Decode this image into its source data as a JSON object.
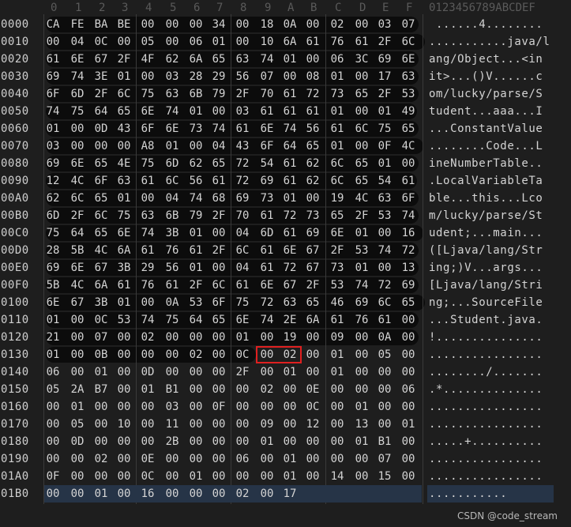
{
  "header": {
    "columns": [
      "0",
      "1",
      "2",
      "3",
      "4",
      "5",
      "6",
      "7",
      "8",
      "9",
      "A",
      "B",
      "C",
      "D",
      "E",
      "F"
    ],
    "ascii_header": "0123456789ABCDEF"
  },
  "rows": [
    {
      "offset": "0000",
      "bytes": [
        "CA",
        "FE",
        "BA",
        "BE",
        "00",
        "00",
        "00",
        "34",
        "00",
        "18",
        "0A",
        "00",
        "02",
        "00",
        "03",
        "07"
      ],
      "ascii": " ......4........"
    },
    {
      "offset": "0010",
      "bytes": [
        "00",
        "04",
        "0C",
        "00",
        "05",
        "00",
        "06",
        "01",
        "00",
        "10",
        "6A",
        "61",
        "76",
        "61",
        "2F",
        "6C"
      ],
      "ascii": "...........java/l"
    },
    {
      "offset": "0020",
      "bytes": [
        "61",
        "6E",
        "67",
        "2F",
        "4F",
        "62",
        "6A",
        "65",
        "63",
        "74",
        "01",
        "00",
        "06",
        "3C",
        "69",
        "6E"
      ],
      "ascii": "ang/Object...<in"
    },
    {
      "offset": "0030",
      "bytes": [
        "69",
        "74",
        "3E",
        "01",
        "00",
        "03",
        "28",
        "29",
        "56",
        "07",
        "00",
        "08",
        "01",
        "00",
        "17",
        "63"
      ],
      "ascii": "it>...()V......c"
    },
    {
      "offset": "0040",
      "bytes": [
        "6F",
        "6D",
        "2F",
        "6C",
        "75",
        "63",
        "6B",
        "79",
        "2F",
        "70",
        "61",
        "72",
        "73",
        "65",
        "2F",
        "53"
      ],
      "ascii": "om/lucky/parse/S"
    },
    {
      "offset": "0050",
      "bytes": [
        "74",
        "75",
        "64",
        "65",
        "6E",
        "74",
        "01",
        "00",
        "03",
        "61",
        "61",
        "61",
        "01",
        "00",
        "01",
        "49"
      ],
      "ascii": "tudent...aaa...I"
    },
    {
      "offset": "0060",
      "bytes": [
        "01",
        "00",
        "0D",
        "43",
        "6F",
        "6E",
        "73",
        "74",
        "61",
        "6E",
        "74",
        "56",
        "61",
        "6C",
        "75",
        "65"
      ],
      "ascii": "...ConstantValue"
    },
    {
      "offset": "0070",
      "bytes": [
        "03",
        "00",
        "00",
        "00",
        "A8",
        "01",
        "00",
        "04",
        "43",
        "6F",
        "64",
        "65",
        "01",
        "00",
        "0F",
        "4C"
      ],
      "ascii": "........Code...L"
    },
    {
      "offset": "0080",
      "bytes": [
        "69",
        "6E",
        "65",
        "4E",
        "75",
        "6D",
        "62",
        "65",
        "72",
        "54",
        "61",
        "62",
        "6C",
        "65",
        "01",
        "00"
      ],
      "ascii": "ineNumberTable.."
    },
    {
      "offset": "0090",
      "bytes": [
        "12",
        "4C",
        "6F",
        "63",
        "61",
        "6C",
        "56",
        "61",
        "72",
        "69",
        "61",
        "62",
        "6C",
        "65",
        "54",
        "61"
      ],
      "ascii": ".LocalVariableTa"
    },
    {
      "offset": "00A0",
      "bytes": [
        "62",
        "6C",
        "65",
        "01",
        "00",
        "04",
        "74",
        "68",
        "69",
        "73",
        "01",
        "00",
        "19",
        "4C",
        "63",
        "6F"
      ],
      "ascii": "ble...this...Lco"
    },
    {
      "offset": "00B0",
      "bytes": [
        "6D",
        "2F",
        "6C",
        "75",
        "63",
        "6B",
        "79",
        "2F",
        "70",
        "61",
        "72",
        "73",
        "65",
        "2F",
        "53",
        "74"
      ],
      "ascii": "m/lucky/parse/St"
    },
    {
      "offset": "00C0",
      "bytes": [
        "75",
        "64",
        "65",
        "6E",
        "74",
        "3B",
        "01",
        "00",
        "04",
        "6D",
        "61",
        "69",
        "6E",
        "01",
        "00",
        "16"
      ],
      "ascii": "udent;...main..."
    },
    {
      "offset": "00D0",
      "bytes": [
        "28",
        "5B",
        "4C",
        "6A",
        "61",
        "76",
        "61",
        "2F",
        "6C",
        "61",
        "6E",
        "67",
        "2F",
        "53",
        "74",
        "72"
      ],
      "ascii": "([Ljava/lang/Str"
    },
    {
      "offset": "00E0",
      "bytes": [
        "69",
        "6E",
        "67",
        "3B",
        "29",
        "56",
        "01",
        "00",
        "04",
        "61",
        "72",
        "67",
        "73",
        "01",
        "00",
        "13"
      ],
      "ascii": "ing;)V...args..."
    },
    {
      "offset": "00F0",
      "bytes": [
        "5B",
        "4C",
        "6A",
        "61",
        "76",
        "61",
        "2F",
        "6C",
        "61",
        "6E",
        "67",
        "2F",
        "53",
        "74",
        "72",
        "69"
      ],
      "ascii": "[Ljava/lang/Stri"
    },
    {
      "offset": "0100",
      "bytes": [
        "6E",
        "67",
        "3B",
        "01",
        "00",
        "0A",
        "53",
        "6F",
        "75",
        "72",
        "63",
        "65",
        "46",
        "69",
        "6C",
        "65"
      ],
      "ascii": "ng;...SourceFile"
    },
    {
      "offset": "0110",
      "bytes": [
        "01",
        "00",
        "0C",
        "53",
        "74",
        "75",
        "64",
        "65",
        "6E",
        "74",
        "2E",
        "6A",
        "61",
        "76",
        "61",
        "00"
      ],
      "ascii": "...Student.java."
    },
    {
      "offset": "0120",
      "bytes": [
        "21",
        "00",
        "07",
        "00",
        "02",
        "00",
        "00",
        "00",
        "01",
        "00",
        "19",
        "00",
        "09",
        "00",
        "0A",
        "00"
      ],
      "ascii": "!..............."
    },
    {
      "offset": "0130",
      "bytes": [
        "01",
        "00",
        "0B",
        "00",
        "00",
        "00",
        "02",
        "00",
        "0C",
        "00",
        "02",
        "00",
        "01",
        "00",
        "05",
        "00"
      ],
      "ascii": "................"
    },
    {
      "offset": "0140",
      "bytes": [
        "06",
        "00",
        "01",
        "00",
        "0D",
        "00",
        "00",
        "00",
        "2F",
        "00",
        "01",
        "00",
        "01",
        "00",
        "00",
        "00"
      ],
      "ascii": "......../......."
    },
    {
      "offset": "0150",
      "bytes": [
        "05",
        "2A",
        "B7",
        "00",
        "01",
        "B1",
        "00",
        "00",
        "00",
        "02",
        "00",
        "0E",
        "00",
        "00",
        "00",
        "06"
      ],
      "ascii": ".*.............."
    },
    {
      "offset": "0160",
      "bytes": [
        "00",
        "01",
        "00",
        "00",
        "00",
        "03",
        "00",
        "0F",
        "00",
        "00",
        "00",
        "0C",
        "00",
        "01",
        "00",
        "00"
      ],
      "ascii": "................"
    },
    {
      "offset": "0170",
      "bytes": [
        "00",
        "05",
        "00",
        "10",
        "00",
        "11",
        "00",
        "00",
        "00",
        "09",
        "00",
        "12",
        "00",
        "13",
        "00",
        "01"
      ],
      "ascii": "................"
    },
    {
      "offset": "0180",
      "bytes": [
        "00",
        "0D",
        "00",
        "00",
        "00",
        "2B",
        "00",
        "00",
        "00",
        "01",
        "00",
        "00",
        "00",
        "01",
        "B1",
        "00"
      ],
      "ascii": ".....+.........."
    },
    {
      "offset": "0190",
      "bytes": [
        "00",
        "00",
        "02",
        "00",
        "0E",
        "00",
        "00",
        "00",
        "06",
        "00",
        "01",
        "00",
        "00",
        "00",
        "07",
        "00"
      ],
      "ascii": "................"
    },
    {
      "offset": "01A0",
      "bytes": [
        "0F",
        "00",
        "00",
        "00",
        "0C",
        "00",
        "01",
        "00",
        "00",
        "00",
        "01",
        "00",
        "14",
        "00",
        "15",
        "00"
      ],
      "ascii": "................"
    },
    {
      "offset": "01B0",
      "bytes": [
        "00",
        "00",
        "01",
        "00",
        "16",
        "00",
        "00",
        "00",
        "02",
        "00",
        "17"
      ],
      "ascii": "..........."
    }
  ],
  "highlight": {
    "row_offset": "0130",
    "bytes": "00 02"
  },
  "watermark": "CSDN @code_stream",
  "colors": {
    "background": "#1e1e1e",
    "text": "#d4d4d4",
    "header": "#5a5a5a",
    "selection": "#263447",
    "redbox": "#e02020"
  }
}
